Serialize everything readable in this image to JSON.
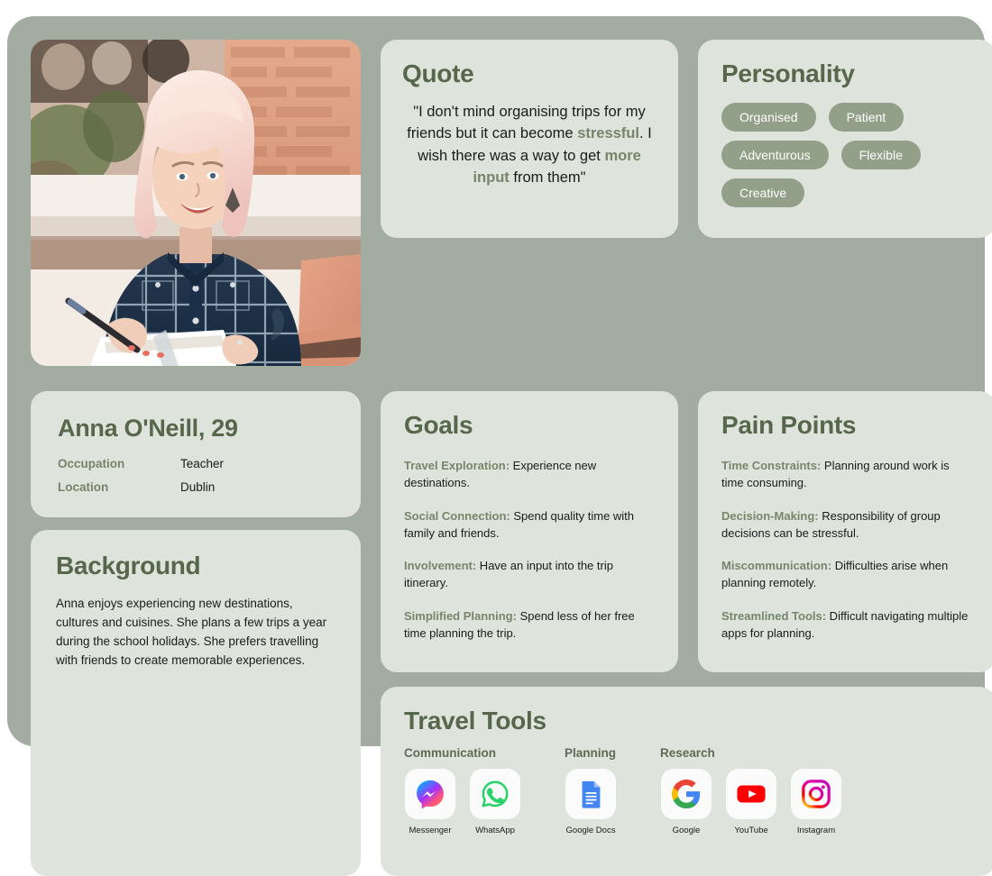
{
  "persona": {
    "photo": {
      "alt": "Smiling woman with pink-blonde hair writing in a notebook at an outdoor cafe table"
    },
    "identity": {
      "name": "Anna O'Neill, 29",
      "details": [
        {
          "label": "Occupation",
          "value": "Teacher"
        },
        {
          "label": "Location",
          "value": "Dublin"
        }
      ]
    },
    "background": {
      "title": "Background",
      "text": "Anna enjoys experiencing new destinations, cultures and cuisines. She plans a few trips a year during the school holidays. She prefers travelling with friends to create memorable experiences."
    },
    "quote": {
      "title": "Quote",
      "segments": [
        {
          "text": "\"I don't mind organising trips for my friends but it can become ",
          "highlight": false
        },
        {
          "text": "stressful",
          "highlight": true
        },
        {
          "text": ". I wish there was a way to get ",
          "highlight": false
        },
        {
          "text": "more input",
          "highlight": true
        },
        {
          "text": " from them\"",
          "highlight": false
        }
      ],
      "full_text": "\"I don't mind organising trips for my friends but it can become stressful. I wish there was a way to get more input from them\""
    },
    "personality": {
      "title": "Personality",
      "tags": [
        "Organised",
        "Patient",
        "Adventurous",
        "Flexible",
        "Creative"
      ]
    },
    "goals": {
      "title": "Goals",
      "items": [
        {
          "label": "Travel Exploration:",
          "text": " Experience new destinations."
        },
        {
          "label": "Social Connection:",
          "text": " Spend quality time with family and friends."
        },
        {
          "label": "Involvement:",
          "text": " Have an input into the trip itinerary."
        },
        {
          "label": "Simplified Planning:",
          "text": " Spend less of her free time planning the trip."
        }
      ]
    },
    "pain_points": {
      "title": "Pain Points",
      "items": [
        {
          "label": "Time Constraints:",
          "text": " Planning around work is time consuming."
        },
        {
          "label": "Decision-Making:",
          "text": " Responsibility of group decisions can be stressful."
        },
        {
          "label": "Miscommunication:",
          "text": " Difficulties arise when planning remotely."
        },
        {
          "label": "Streamlined Tools:",
          "text": " Difficult navigating multiple apps for planning."
        }
      ]
    },
    "travel_tools": {
      "title": "Travel Tools",
      "groups": [
        {
          "label": "Communication",
          "tools": [
            {
              "name": "Messenger",
              "icon": "messenger-icon"
            },
            {
              "name": "WhatsApp",
              "icon": "whatsapp-icon"
            }
          ]
        },
        {
          "label": "Planning",
          "tools": [
            {
              "name": "Google Docs",
              "icon": "google-docs-icon"
            }
          ]
        },
        {
          "label": "Research",
          "tools": [
            {
              "name": "Google",
              "icon": "google-icon"
            },
            {
              "name": "YouTube",
              "icon": "youtube-icon"
            },
            {
              "name": "Instagram",
              "icon": "instagram-icon"
            }
          ]
        }
      ]
    }
  },
  "colors": {
    "panel": "#a3aca0",
    "card": "#dee3dc",
    "heading": "#56674b",
    "accent": "#76866b",
    "tag": "#93a089",
    "tag_text": "#ffffff",
    "body_text": "#1b1b1b"
  }
}
